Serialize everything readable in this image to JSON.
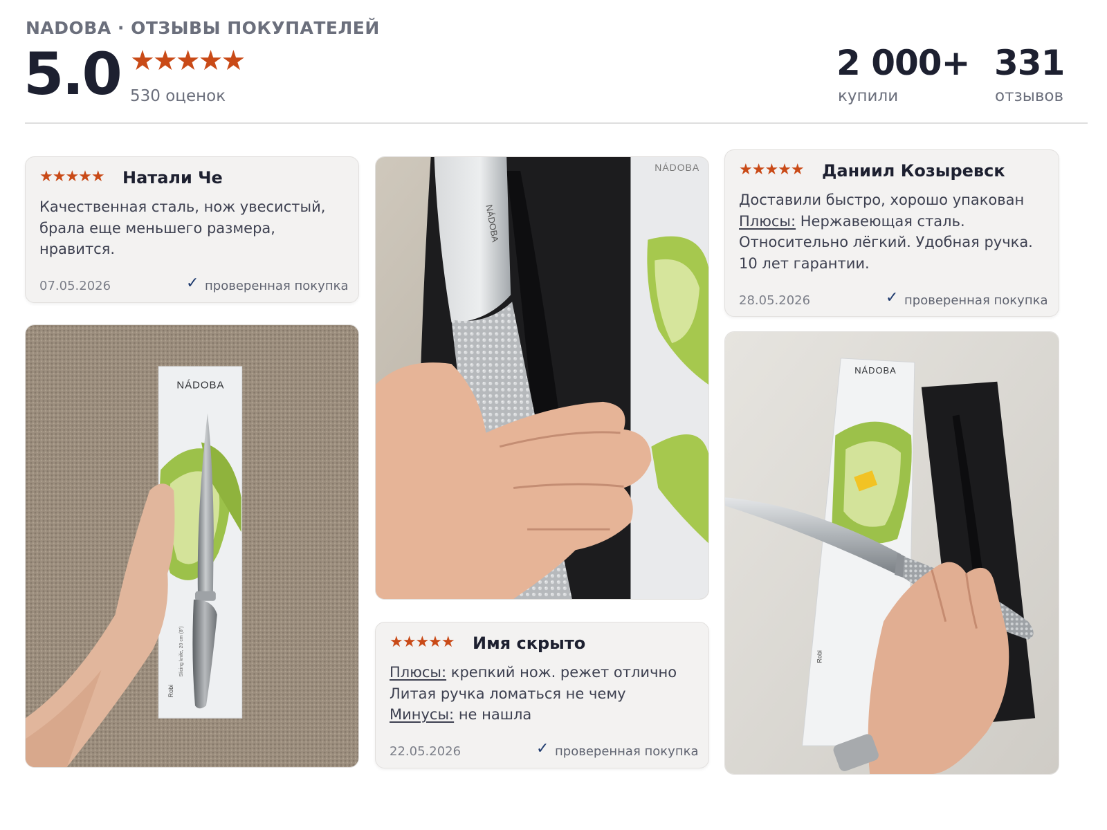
{
  "header": {
    "brand": "NADOBA · ОТЗЫВЫ ПОКУПАТЕЛЕЙ",
    "score": "5.0",
    "stars": "★★★★★",
    "ratings_count": "530 оценок",
    "bought_value": "2 000+",
    "bought_label": "купили",
    "reviews_value": "331",
    "reviews_label": "отзывов"
  },
  "reviews": [
    {
      "stars": "★★★★★",
      "author": "Натали Че",
      "text_lines": [
        "Качественная сталь, нож увесистый,",
        "брала еще меньшего размера,",
        "нравится."
      ],
      "date": "07.05.2026",
      "verified": "проверенная покупка"
    },
    {
      "stars": "★★★★★",
      "author": "Имя скрыто",
      "pros_label": "Плюсы:",
      "pros_text": " крепкий нож. режет отлично",
      "line2": "Литая ручка ломаться не чему",
      "cons_label": "Минусы:",
      "cons_text": " не нашла",
      "date": "22.05.2026",
      "verified": "проверенная покупка"
    },
    {
      "stars": "★★★★★",
      "author": "Даниил Козыревск",
      "line1": "Доставили быстро, хорошо упакован",
      "pros_label": "Плюсы:",
      "pros_text": " Нержавеющая сталь.",
      "line3": "Относительно лёгкий. Удобная ручка.",
      "line4": "10 лет гарантии.",
      "date": "28.05.2026",
      "verified": "проверенная покупка"
    }
  ],
  "photos": {
    "box_brand": "NÁDOBA",
    "box_model": "Robi",
    "box_desc": "Slicing knife, 20 cm (8\")"
  },
  "colors": {
    "star": "#c94a17",
    "card_bg": "#f3f2f1",
    "check": "#1e3a6e"
  }
}
